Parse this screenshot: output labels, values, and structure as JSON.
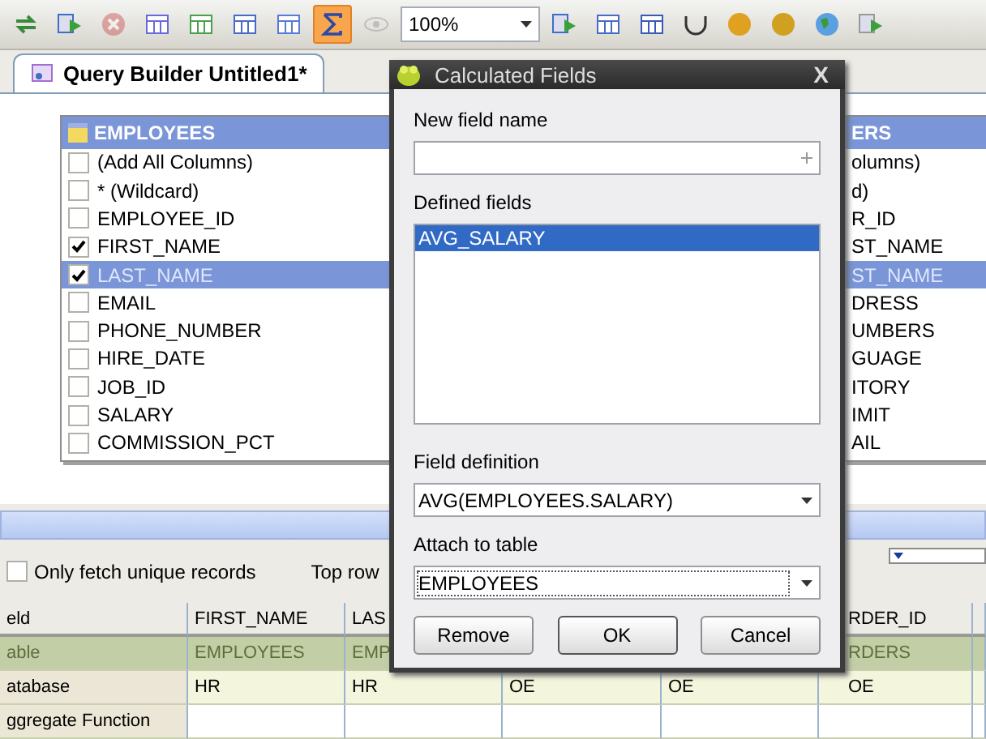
{
  "toolbar": {
    "buttons": [
      {
        "kind": "refresh",
        "selected": false,
        "disabled": false
      },
      {
        "kind": "run",
        "selected": false,
        "disabled": false
      },
      {
        "kind": "stop",
        "selected": false,
        "disabled": true
      },
      {
        "kind": "edit",
        "selected": false,
        "disabled": false
      },
      {
        "kind": "diagram",
        "selected": false,
        "disabled": false
      },
      {
        "kind": "table",
        "selected": false,
        "disabled": false
      },
      {
        "kind": "grid",
        "selected": false,
        "disabled": false
      },
      {
        "kind": "sigma",
        "selected": true,
        "disabled": false
      },
      {
        "kind": "eye",
        "selected": false,
        "disabled": true
      }
    ],
    "zoom": "100%",
    "right_buttons": [
      {
        "kind": "run"
      },
      {
        "kind": "list"
      },
      {
        "kind": "select"
      },
      {
        "kind": "union"
      },
      {
        "kind": "letter-a"
      },
      {
        "kind": "letter-w"
      },
      {
        "kind": "globe"
      },
      {
        "kind": "next"
      }
    ]
  },
  "tab": {
    "label": "Query Builder Untitled1*",
    "selected": true
  },
  "tables": [
    {
      "title": "EMPLOYEES",
      "clipped": false,
      "columns": [
        {
          "name": "(Add All Columns)",
          "checked": false,
          "selected": false
        },
        {
          "name": "* (Wildcard)",
          "checked": false,
          "selected": false
        },
        {
          "name": "EMPLOYEE_ID",
          "checked": false,
          "selected": false
        },
        {
          "name": "FIRST_NAME",
          "checked": true,
          "selected": false
        },
        {
          "name": "LAST_NAME",
          "checked": true,
          "selected": true
        },
        {
          "name": "EMAIL",
          "checked": false,
          "selected": false
        },
        {
          "name": "PHONE_NUMBER",
          "checked": false,
          "selected": false
        },
        {
          "name": "HIRE_DATE",
          "checked": false,
          "selected": false
        },
        {
          "name": "JOB_ID",
          "checked": false,
          "selected": false
        },
        {
          "name": "SALARY",
          "checked": false,
          "selected": false
        },
        {
          "name": "COMMISSION_PCT",
          "checked": false,
          "selected": false
        }
      ]
    },
    {
      "title": "ERS",
      "clipped": true,
      "columns": [
        {
          "name": "olumns)",
          "selected": false
        },
        {
          "name": "d)",
          "selected": false
        },
        {
          "name": "R_ID",
          "selected": false
        },
        {
          "name": "ST_NAME",
          "selected": false
        },
        {
          "name": "ST_NAME",
          "selected": true
        },
        {
          "name": "DRESS",
          "selected": false
        },
        {
          "name": "UMBERS",
          "selected": false
        },
        {
          "name": "GUAGE",
          "selected": false
        },
        {
          "name": "ITORY",
          "selected": false
        },
        {
          "name": "IMIT",
          "selected": false
        },
        {
          "name": "AIL",
          "selected": false
        }
      ]
    }
  ],
  "options": {
    "unique": {
      "label": "Only fetch unique records",
      "checked": false
    },
    "top_rows": "Top row"
  },
  "grid": {
    "columns": [
      "eld",
      "FIRST_NAME",
      "LAS",
      null,
      null,
      "RDER_ID"
    ],
    "rows": [
      {
        "kind": "table",
        "cells": [
          "able",
          "EMPLOYEES",
          "EMP",
          null,
          null,
          "RDERS"
        ]
      },
      {
        "kind": "normal",
        "cells": [
          "atabase",
          "HR",
          "HR",
          "OE",
          "OE",
          "OE"
        ]
      },
      {
        "kind": "empty",
        "cells": [
          "ggregate Function",
          null,
          null,
          null,
          null,
          null
        ]
      }
    ]
  },
  "dialog": {
    "title": "Calculated Fields",
    "new_field_label": "New field name",
    "defined_label": "Defined fields",
    "defined_fields": [
      {
        "name": "AVG_SALARY",
        "selected": true
      }
    ],
    "definition_label": "Field definition",
    "definition": "AVG(EMPLOYEES.SALARY)",
    "attach_label": "Attach to table",
    "attach": "EMPLOYEES",
    "buttons": [
      {
        "label": "Remove",
        "kind": "normal"
      },
      {
        "label": "OK",
        "kind": "default"
      },
      {
        "label": "Cancel",
        "kind": "normal"
      }
    ],
    "close": "X"
  }
}
